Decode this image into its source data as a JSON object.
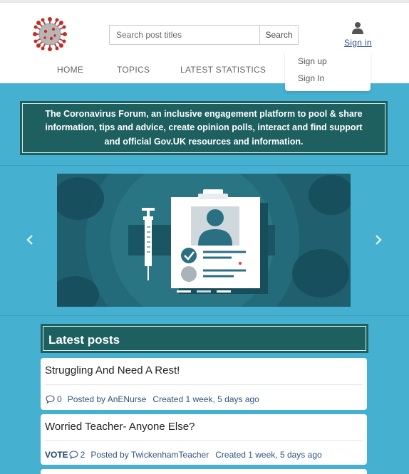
{
  "header": {
    "search": {
      "placeholder": "Search post titles",
      "button_label": "Search"
    },
    "sign_in_label": "Sign in",
    "nav": [
      "HOME",
      "TOPICS",
      "LATEST STATISTICS"
    ],
    "dropdown": [
      "Sign up",
      "Sign In"
    ]
  },
  "banner": {
    "text": "The Coronavirus Forum, an inclusive engagement platform to pool & share information, tips and advice, create opinion polls, interact and find support and official Gov.UK resources and information."
  },
  "latest": {
    "title": "Latest posts",
    "posts": [
      {
        "title": "Struggling And Need A Rest!",
        "vote": "",
        "comments": "0",
        "posted_by": "Posted by AnENurse",
        "created": "Created 1 week, 5 days ago"
      },
      {
        "title": "Worried Teacher- Anyone Else?",
        "vote": "VOTE",
        "comments": "2",
        "posted_by": "Posted by TwickenhamTeacher",
        "created": "Created 1 week, 5 days ago"
      }
    ]
  },
  "colors": {
    "page_bg": "#45b0cf",
    "accent": "#1e6060",
    "link": "#2c4d8a",
    "meta": "#2e5580"
  },
  "icons": [
    "virus-logo-icon",
    "user-icon",
    "chevron-left-icon",
    "chevron-right-icon",
    "comment-icon"
  ]
}
